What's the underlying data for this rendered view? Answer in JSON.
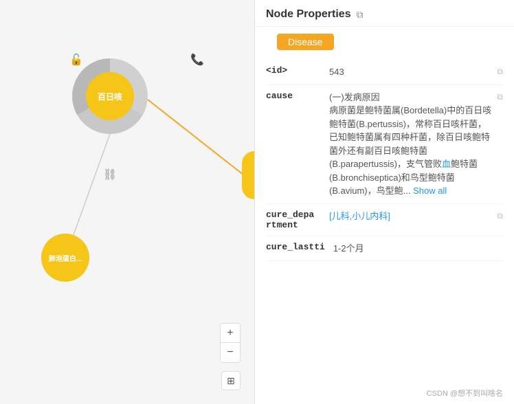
{
  "leftPanel": {
    "centralNode": {
      "label": "百日咳"
    },
    "secondaryNode": {
      "label": "肺泡蛋白..."
    },
    "zoomControls": {
      "zoomIn": "+",
      "zoomOut": "−",
      "mapIcon": "⊞"
    }
  },
  "rightPanel": {
    "title": "Node Properties",
    "copyIconLabel": "copy",
    "badge": "Disease",
    "properties": [
      {
        "key": "<id>",
        "value": "543",
        "copyable": true
      },
      {
        "key": "cause",
        "value": "(一)发病原因\n病原菌是鲍特菌属(Bordetella)中的百日咳鲍特菌(B.pertussis)，常称百日咳杆菌，已知鲍特菌属有四种杆菌，除百日咳鲍特菌外还有副百日咳鲍特菌(B.parapertussis)，支气管败血鲍特菌(B.bronchiseptica)和鸟型鲍特菌(B.avium)，鸟型鲍... Show all",
        "copyable": true,
        "hasShowAll": true
      },
      {
        "key": "cure_department",
        "value": "[儿科,小儿内科]",
        "copyable": true
      },
      {
        "key": "cure_lastti",
        "value": "1-2个月",
        "copyable": false,
        "hasWatermark": true
      }
    ],
    "watermark": "CSDN @想不到叫啥名"
  }
}
